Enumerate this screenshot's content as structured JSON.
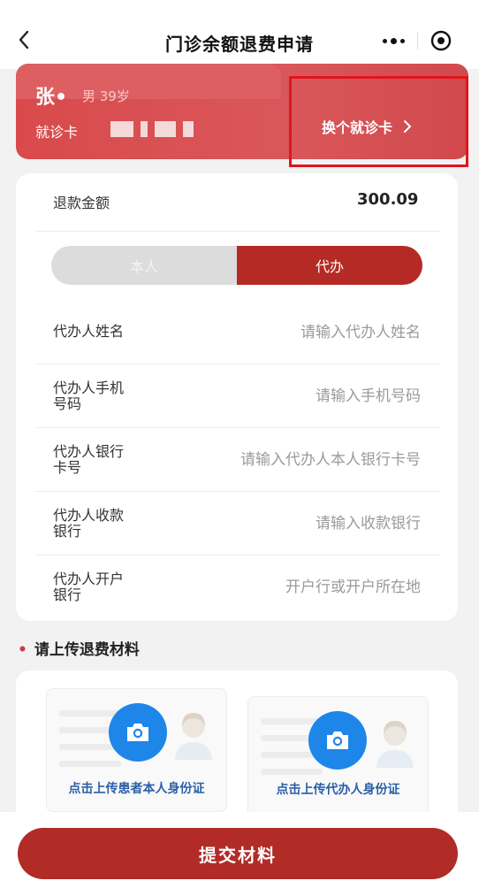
{
  "navbar": {
    "title": "门诊余额退费申请",
    "back_icon": "chevron-left-icon",
    "more_icon": "more-dots-icon",
    "target_icon": "target-icon"
  },
  "card": {
    "patient_name": "张•",
    "patient_info": "男 39岁",
    "card_label": "就诊卡",
    "switch_label": "换个就诊卡",
    "switch_icon": "chevron-right-icon",
    "color": "#d94a4c"
  },
  "refund": {
    "amount_label": "退款金额",
    "amount_value": "300.09"
  },
  "toggle": {
    "self_label": "本人",
    "proxy_label": "代办",
    "selected": "代办",
    "active_color": "#b52a25"
  },
  "fields": [
    {
      "label": "代办人姓名",
      "placeholder": "请输入代办人姓名"
    },
    {
      "label": "代办人手机号码",
      "placeholder": "请输入手机号码"
    },
    {
      "label": "代办人银行卡号",
      "placeholder": "请输入代办人本人银行卡号"
    },
    {
      "label": "代办人收款银行",
      "placeholder": "请输入收款银行"
    },
    {
      "label": "代办人开户银行",
      "placeholder": "开户行或开户所在地"
    }
  ],
  "upload": {
    "required_mark": "•",
    "title": "请上传退费材料",
    "patient_id_caption": "点击上传患者本人身份证",
    "proxy_id_caption": "点击上传代办人身份证",
    "camera_icon": "camera-icon",
    "accent": "#1e86e9"
  },
  "submit": {
    "label": "提交材料",
    "color": "#b12b27"
  }
}
